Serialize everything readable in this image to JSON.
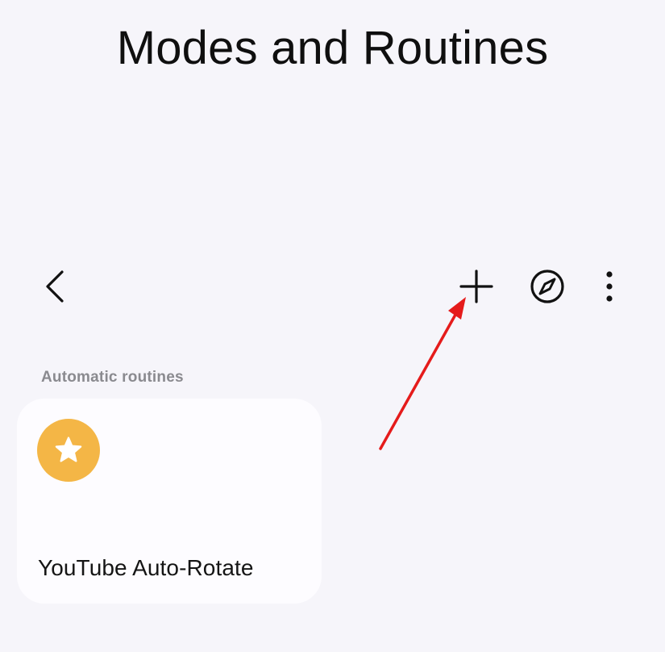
{
  "header": {
    "title": "Modes and Routines"
  },
  "toolbar": {
    "back_icon": "chevron-left-icon",
    "add_icon": "plus-icon",
    "explore_icon": "compass-icon",
    "more_icon": "more-vertical-icon"
  },
  "sections": [
    {
      "label": "Automatic routines",
      "routines": [
        {
          "name": "YouTube Auto-Rotate",
          "icon": "star-icon",
          "icon_color": "#f4b646"
        }
      ]
    }
  ],
  "annotation": {
    "type": "arrow",
    "color": "#e51b1b",
    "target": "add-button"
  },
  "colors": {
    "background": "#f6f5fa",
    "card": "#fdfcff",
    "section_label": "#8a8a8f"
  }
}
